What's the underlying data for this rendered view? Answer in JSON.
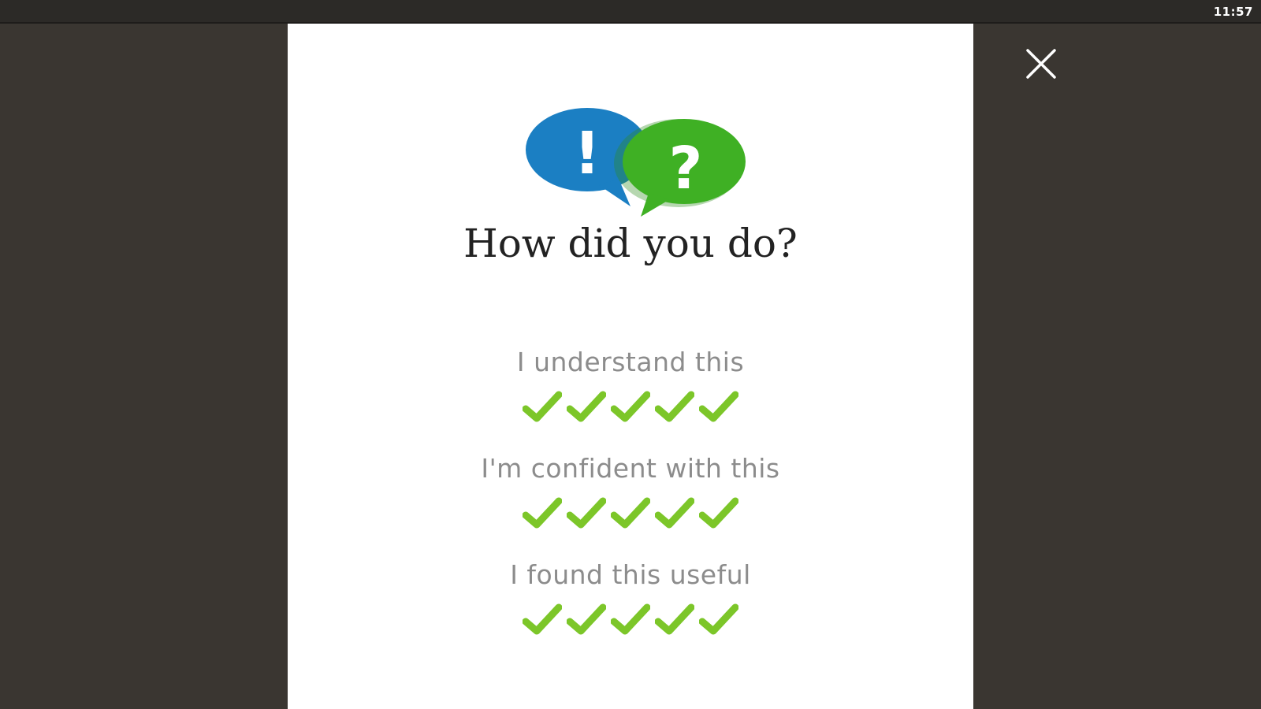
{
  "status_bar": {
    "time": "11:57"
  },
  "dialog": {
    "title": "How did you do?",
    "ratings": [
      {
        "label": "I understand this",
        "checks": 5
      },
      {
        "label": "I'm confident with this",
        "checks": 5
      },
      {
        "label": "I found this useful",
        "checks": 5
      }
    ],
    "icons": {
      "close": "close-icon",
      "bubbles": "speech-bubbles-icon",
      "check": "checkmark-icon"
    }
  },
  "colors": {
    "background": "#3a3631",
    "panel": "#ffffff",
    "bubble_blue": "#1b7fc3",
    "bubble_green": "#3fb024",
    "check_green": "#7cc629",
    "label_gray": "#8c8c8c",
    "title": "#222222"
  }
}
